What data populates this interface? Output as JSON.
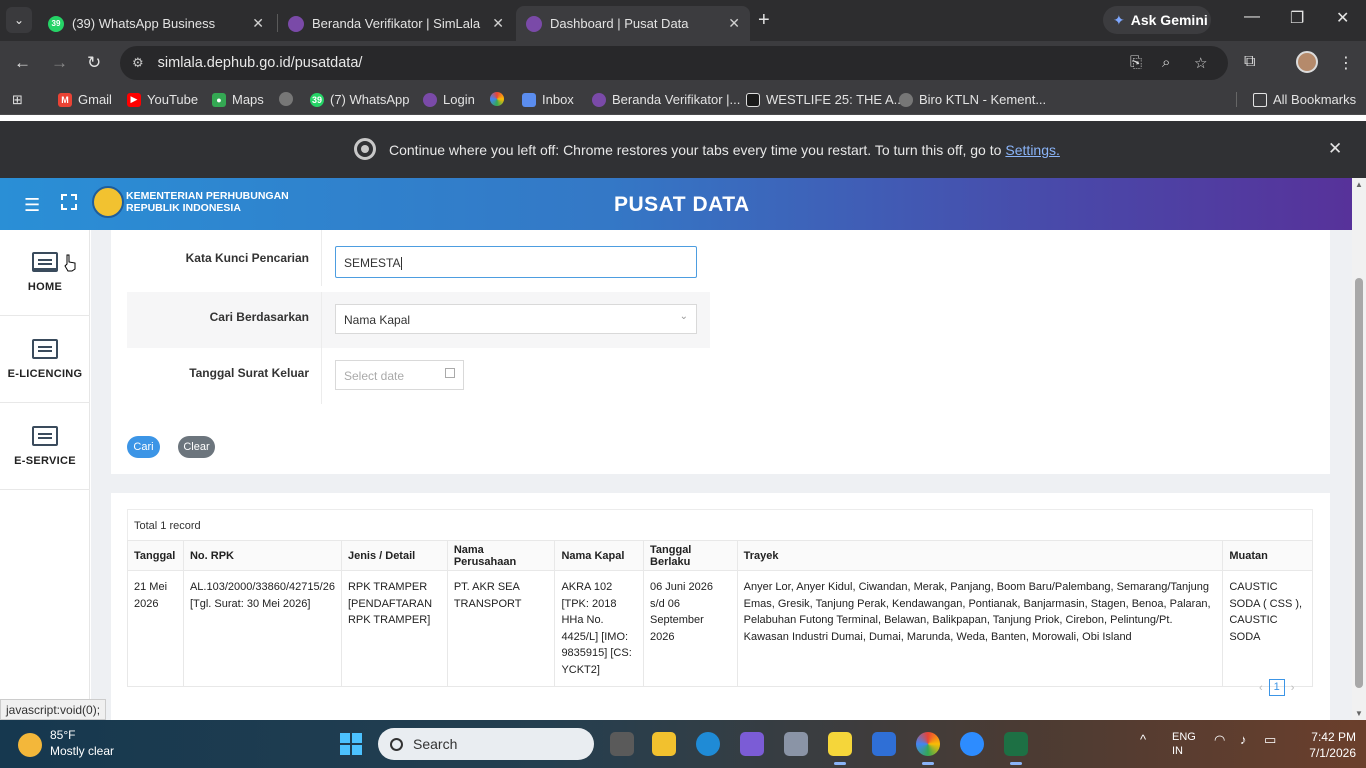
{
  "browser": {
    "tabs": [
      {
        "title": "(39) WhatsApp Business",
        "badge": "39",
        "active": false
      },
      {
        "title": "Beranda Verifikator | SimLala",
        "active": false
      },
      {
        "title": "Dashboard | Pusat Data",
        "active": true
      }
    ],
    "ask_gemini": "Ask Gemini",
    "url": "simlala.dephub.go.id/pusatdata/",
    "bookmarks": [
      {
        "label": "Gmail"
      },
      {
        "label": "YouTube"
      },
      {
        "label": "Maps"
      },
      {
        "label": ""
      },
      {
        "label": "(7) WhatsApp",
        "badge": "39"
      },
      {
        "label": "Login"
      },
      {
        "label": ""
      },
      {
        "label": "Inbox"
      },
      {
        "label": "Beranda Verifikator |..."
      },
      {
        "label": "WESTLIFE 25: THE A..."
      },
      {
        "label": "Biro KTLN - Kement..."
      }
    ],
    "all_bookmarks": "All Bookmarks",
    "infobar": {
      "message": "Continue where you left off: Chrome restores your tabs every time you restart. To turn this off, go to",
      "link": "Settings."
    },
    "status_url": "javascript:void(0);"
  },
  "app": {
    "ministry_line1": "KEMENTERIAN PERHUBUNGAN",
    "ministry_line2": "REPUBLIK INDONESIA",
    "title": "PUSAT DATA",
    "sidebar": [
      {
        "label": "HOME"
      },
      {
        "label": "E-LICENCING"
      },
      {
        "label": "E-SERVICE"
      }
    ],
    "form": {
      "keyword_label": "Kata Kunci Pencarian",
      "keyword_value": "SEMESTA",
      "searchby_label": "Cari Berdasarkan",
      "searchby_value": "Nama Kapal",
      "date_label": "Tanggal Surat Keluar",
      "date_placeholder": "Select date",
      "search_button": "Cari",
      "clear_button": "Clear"
    },
    "results": {
      "total": "Total 1 record",
      "columns": [
        "Tanggal",
        "No. RPK",
        "Jenis / Detail",
        "Nama Perusahaan",
        "Nama Kapal",
        "Tanggal Berlaku",
        "Trayek",
        "Muatan"
      ],
      "rows": [
        {
          "tanggal": "21 Mei 2026",
          "no_rpk": "AL.103/2000/33860/42715/26 [Tgl. Surat: 30 Mei 2026]",
          "jenis": "RPK TRAMPER [PENDAFTARAN RPK TRAMPER]",
          "perusahaan": "PT. AKR SEA TRANSPORT",
          "kapal": "AKRA 102 [TPK: 2018 HHa No. 4425/L] [IMO: 9835915] [CS: YCKT2]",
          "berlaku": "06 Juni 2026 s/d 06 September 2026",
          "trayek": "Anyer Lor, Anyer Kidul, Ciwandan, Merak, Panjang, Boom Baru/Palembang, Semarang/Tanjung Emas, Gresik, Tanjung Perak, Kendawangan, Pontianak, Banjarmasin, Stagen, Benoa, Palaran, Pelabuhan Futong Terminal, Belawan, Balikpapan, Tanjung Priok, Cirebon, Pelintung/Pt. Kawasan Industri Dumai, Dumai, Marunda, Weda, Banten, Morowali, Obi Island",
          "muatan": "CAUSTIC SODA ( CSS ), CAUSTIC SODA"
        }
      ],
      "page": "1"
    }
  },
  "taskbar": {
    "temperature": "85°F",
    "weather": "Mostly clear",
    "search": "Search",
    "lang1": "ENG",
    "lang2": "IN",
    "time": "7:42 PM",
    "date": "7/1/2026"
  }
}
